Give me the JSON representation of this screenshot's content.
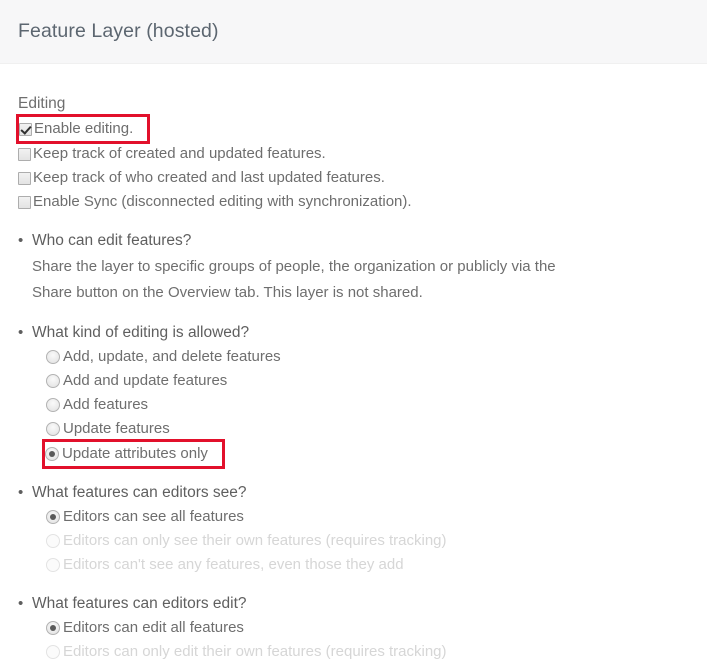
{
  "header": {
    "title": "Feature Layer (hosted)"
  },
  "accent": {
    "highlight_red": "#e2102b",
    "text_gray": "#6e6e6e",
    "disabled_gray": "#d6d6d6",
    "header_bg": "#f7f7f8"
  },
  "editing": {
    "section_label": "Editing",
    "checkboxes": [
      {
        "label": "Enable editing.",
        "checked": true,
        "highlighted": true
      },
      {
        "label": "Keep track of created and updated features.",
        "checked": false,
        "highlighted": false
      },
      {
        "label": "Keep track of who created and last updated features.",
        "checked": false,
        "highlighted": false
      },
      {
        "label": "Enable Sync (disconnected editing with synchronization).",
        "checked": false,
        "highlighted": false
      }
    ]
  },
  "questions": [
    {
      "title": "Who can edit features?",
      "paragraph_line1": "Share the layer to specific groups of people, the organization or publicly via the",
      "paragraph_line2": "Share button on the Overview tab. This layer is not shared."
    },
    {
      "title": "What kind of editing is allowed?",
      "options": [
        {
          "label": "Add, update, and delete features",
          "selected": false,
          "disabled": false,
          "highlighted": false
        },
        {
          "label": "Add and update features",
          "selected": false,
          "disabled": false,
          "highlighted": false
        },
        {
          "label": "Add features",
          "selected": false,
          "disabled": false,
          "highlighted": false
        },
        {
          "label": "Update features",
          "selected": false,
          "disabled": false,
          "highlighted": false
        },
        {
          "label": "Update attributes only",
          "selected": true,
          "disabled": false,
          "highlighted": true
        }
      ]
    },
    {
      "title": "What features can editors see?",
      "options": [
        {
          "label": "Editors can see all features",
          "selected": true,
          "disabled": false,
          "highlighted": false
        },
        {
          "label": "Editors can only see their own features (requires tracking)",
          "selected": false,
          "disabled": true,
          "highlighted": false
        },
        {
          "label": "Editors can't see any features, even those they add",
          "selected": false,
          "disabled": true,
          "highlighted": false
        }
      ]
    },
    {
      "title": "What features can editors edit?",
      "options": [
        {
          "label": "Editors can edit all features",
          "selected": true,
          "disabled": false,
          "highlighted": false
        },
        {
          "label": "Editors can only edit their own features (requires tracking)",
          "selected": false,
          "disabled": true,
          "highlighted": false
        }
      ]
    }
  ]
}
